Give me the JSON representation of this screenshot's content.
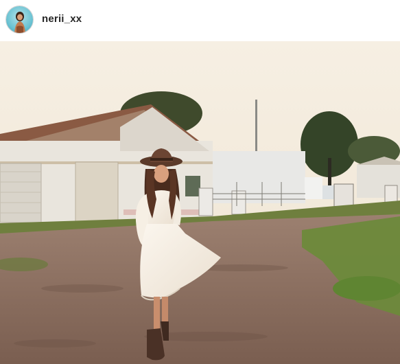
{
  "post": {
    "username": "nerii_xx",
    "avatar_icon": "profile-avatar-icon",
    "image_icon": "post-photo-image"
  },
  "colors": {
    "username": "#262626",
    "header_border": "#efefef",
    "avatar_ring": "#6cc3d3"
  }
}
